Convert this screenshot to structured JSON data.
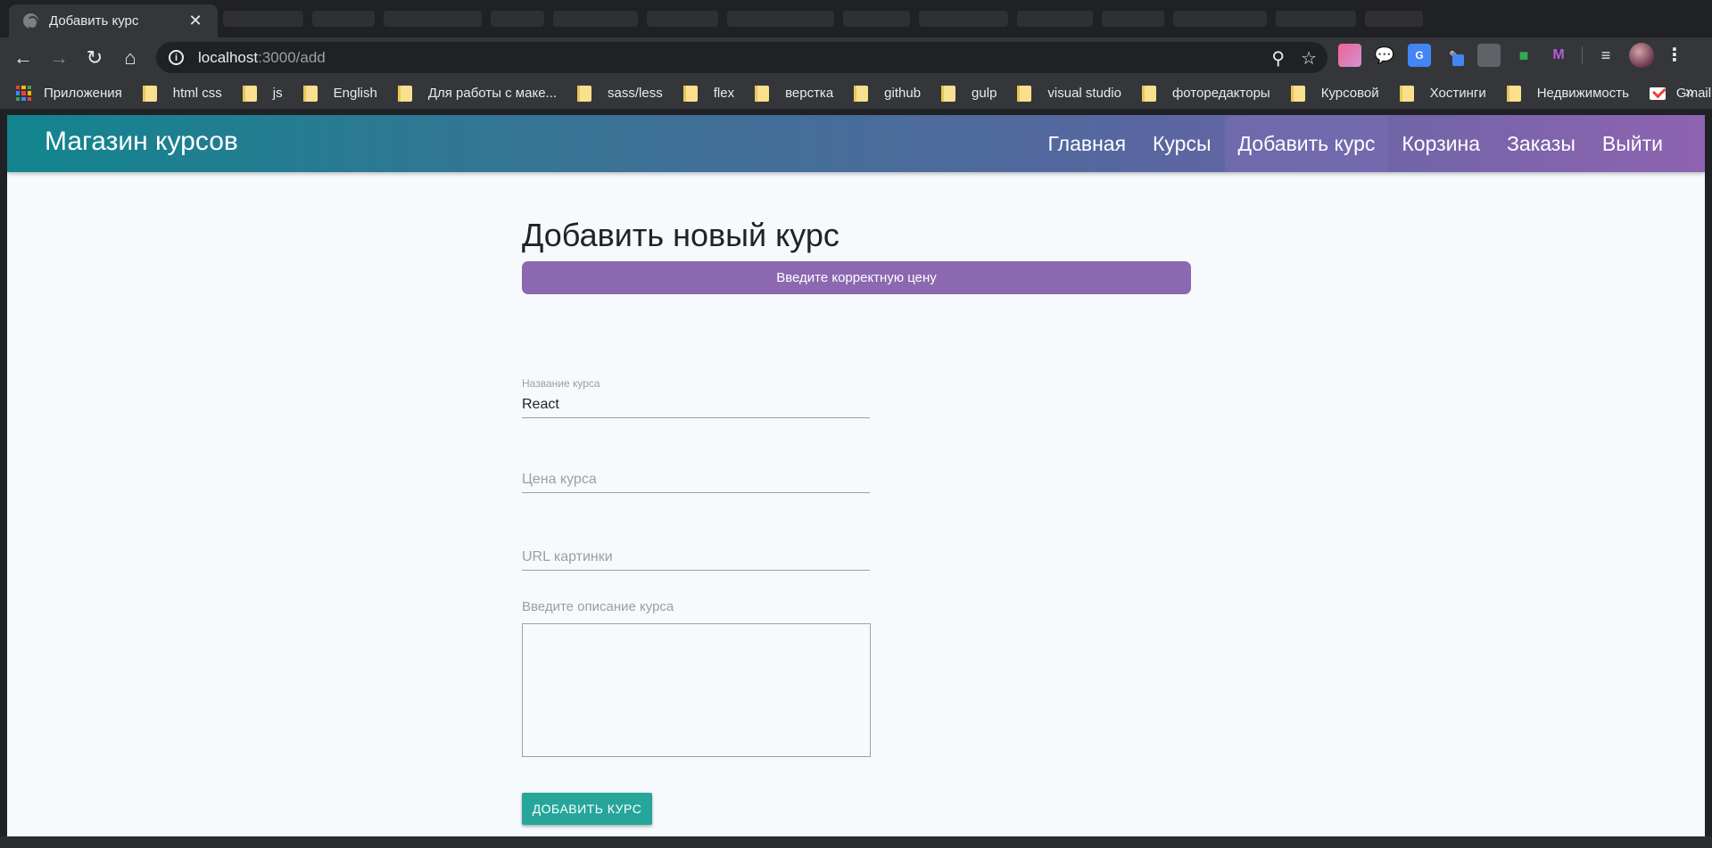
{
  "browser": {
    "tab_title": "Добавить курс",
    "tab_close": "✕",
    "url_host": "localhost",
    "url_path": ":3000/add",
    "bookmarks": [
      {
        "label": "Приложения",
        "icon": "apps-icon"
      },
      {
        "label": "html css",
        "icon": "folder-icon"
      },
      {
        "label": "js",
        "icon": "folder-icon"
      },
      {
        "label": "English",
        "icon": "folder-icon"
      },
      {
        "label": "Для работы с маке...",
        "icon": "folder-icon"
      },
      {
        "label": "sass/less",
        "icon": "folder-icon"
      },
      {
        "label": "flex",
        "icon": "folder-icon"
      },
      {
        "label": "верстка",
        "icon": "folder-icon"
      },
      {
        "label": "github",
        "icon": "folder-icon"
      },
      {
        "label": "gulp",
        "icon": "folder-icon"
      },
      {
        "label": "visual studio",
        "icon": "folder-icon"
      },
      {
        "label": "фоторедакторы",
        "icon": "folder-icon"
      },
      {
        "label": "Курсовой",
        "icon": "folder-icon"
      },
      {
        "label": "Хостинги",
        "icon": "folder-icon"
      },
      {
        "label": "Недвижимость",
        "icon": "folder-icon"
      },
      {
        "label": "Gmail",
        "icon": "gmail-icon"
      }
    ],
    "bookmarks_more": "»"
  },
  "navbar": {
    "brand": "Магазин курсов",
    "links": [
      {
        "label": "Главная",
        "active": false
      },
      {
        "label": "Курсы",
        "active": false
      },
      {
        "label": "Добавить курс",
        "active": true
      },
      {
        "label": "Корзина",
        "active": false
      },
      {
        "label": "Заказы",
        "active": false
      },
      {
        "label": "Выйти",
        "active": false
      }
    ]
  },
  "form": {
    "title": "Добавить новый курс",
    "alert": "Введите корректную цену",
    "title_label": "Название курса",
    "title_value": "React",
    "price_placeholder": "Цена курса",
    "image_placeholder": "URL картинки",
    "description_label": "Введите описание курса",
    "description_value": "",
    "submit_label": "ДОБАВИТЬ КУРС"
  },
  "colors": {
    "alert_bg": "#8b68b0",
    "submit_bg": "#26a69a",
    "navbar_start": "#12858e",
    "navbar_end": "#8f63b0"
  }
}
